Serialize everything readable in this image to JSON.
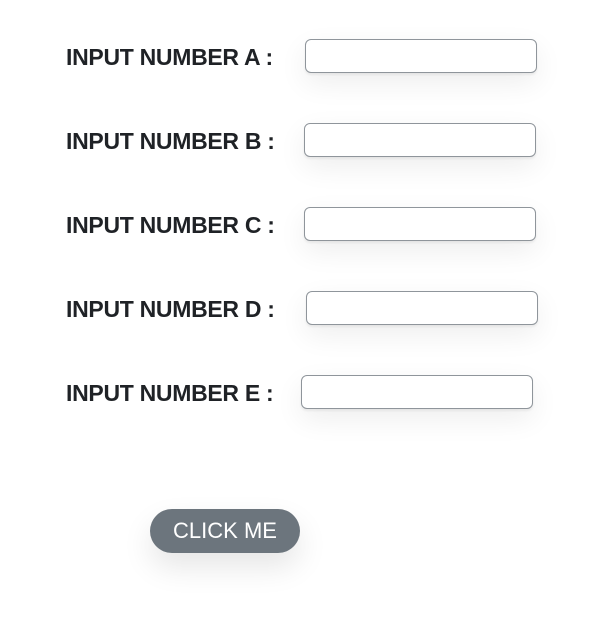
{
  "form": {
    "fields": [
      {
        "label": "INPUT NUMBER A :",
        "value": "",
        "placeholder": ""
      },
      {
        "label": "INPUT NUMBER B :",
        "value": "",
        "placeholder": ""
      },
      {
        "label": "INPUT NUMBER C :",
        "value": "",
        "placeholder": ""
      },
      {
        "label": "INPUT NUMBER D :",
        "value": "",
        "placeholder": ""
      },
      {
        "label": "INPUT NUMBER E :",
        "value": "",
        "placeholder": ""
      }
    ],
    "submit_label": "CLICK ME"
  },
  "colors": {
    "button_bg": "#6c757d",
    "button_text": "#ffffff",
    "label_text": "#1f2226",
    "input_border": "#8f959b"
  }
}
